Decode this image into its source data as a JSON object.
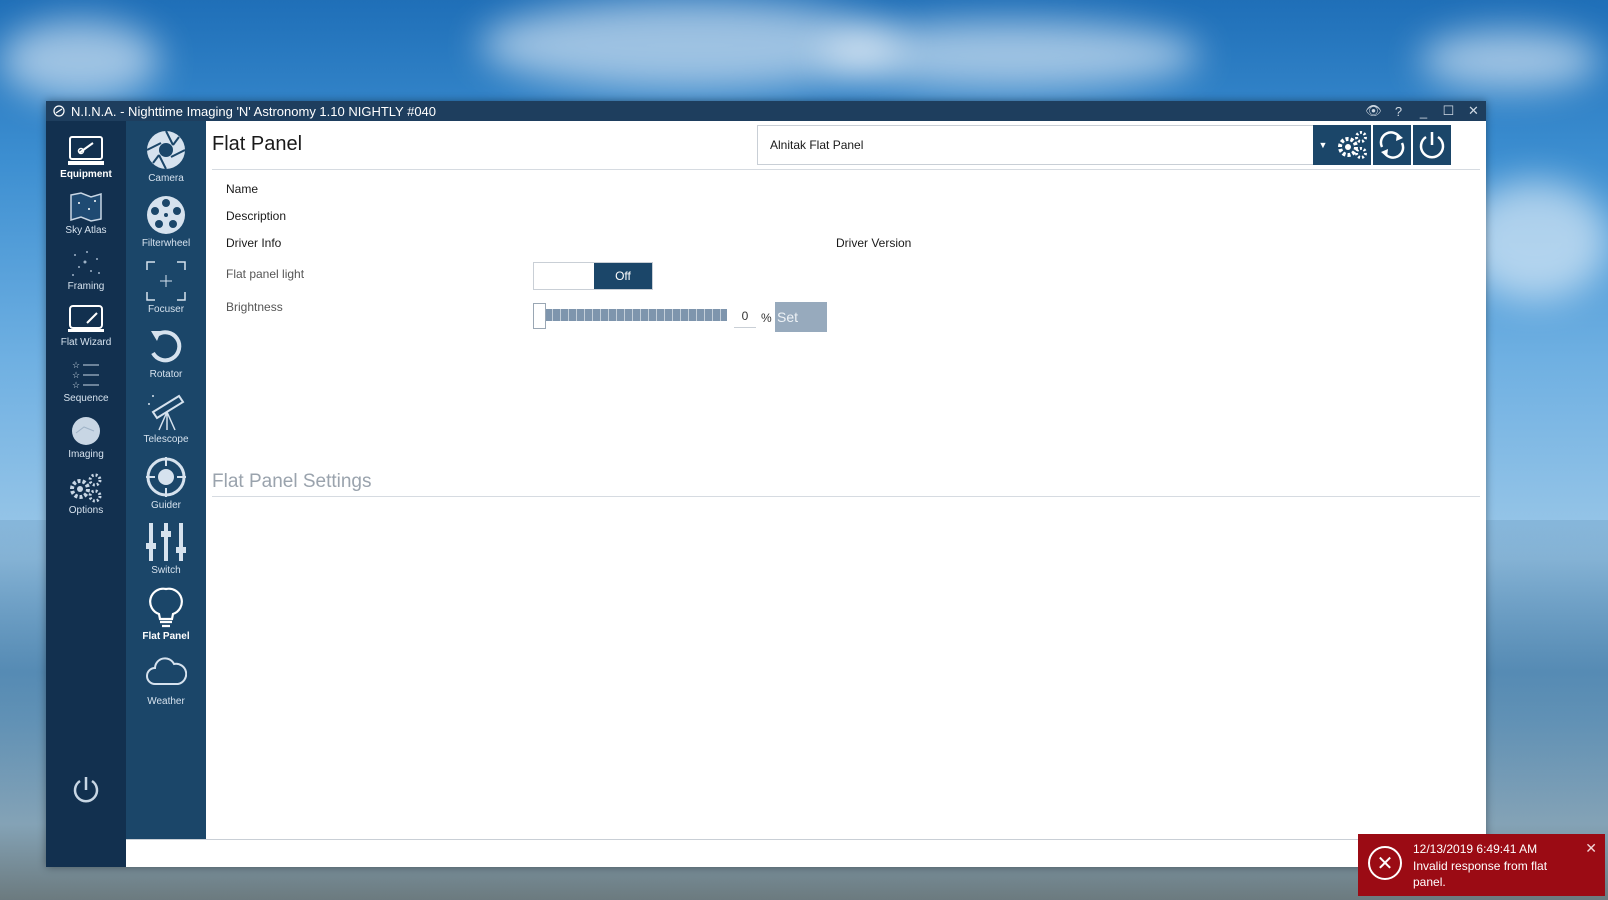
{
  "window": {
    "title": "N.I.N.A. - Nighttime Imaging 'N' Astronomy 1.10 NIGHTLY #040"
  },
  "title_controls": [
    {
      "name": "eye-icon",
      "glyph": "👁"
    },
    {
      "name": "help-icon",
      "glyph": "?"
    },
    {
      "name": "minimize-icon",
      "glyph": "_"
    },
    {
      "name": "maximize-icon",
      "glyph": "☐"
    },
    {
      "name": "close-icon",
      "glyph": "✕"
    }
  ],
  "main_nav": {
    "items": [
      {
        "label": "Equipment",
        "icon": "equipment-icon",
        "active": true
      },
      {
        "label": "Sky Atlas",
        "icon": "sky-atlas-icon"
      },
      {
        "label": "Framing",
        "icon": "framing-icon"
      },
      {
        "label": "Flat Wizard",
        "icon": "flat-wizard-icon"
      },
      {
        "label": "Sequence",
        "icon": "sequence-icon"
      },
      {
        "label": "Imaging",
        "icon": "imaging-icon"
      },
      {
        "label": "Options",
        "icon": "options-icon"
      }
    ],
    "power_icon": "power-icon"
  },
  "equipment_nav": {
    "items": [
      {
        "label": "Camera",
        "icon": "camera-aperture-icon"
      },
      {
        "label": "Filterwheel",
        "icon": "filterwheel-icon"
      },
      {
        "label": "Focuser",
        "icon": "focuser-icon"
      },
      {
        "label": "Rotator",
        "icon": "rotator-icon"
      },
      {
        "label": "Telescope",
        "icon": "telescope-icon"
      },
      {
        "label": "Guider",
        "icon": "guider-icon"
      },
      {
        "label": "Switch",
        "icon": "switch-icon"
      },
      {
        "label": "Flat Panel",
        "icon": "lightbulb-icon",
        "active": true
      },
      {
        "label": "Weather",
        "icon": "cloud-icon"
      }
    ]
  },
  "page": {
    "title": "Flat Panel",
    "device_selected": "Alnitak Flat Panel",
    "fields": {
      "name_label": "Name",
      "description_label": "Description",
      "driver_info_label": "Driver Info",
      "driver_version_label": "Driver Version"
    },
    "controls": {
      "light_label": "Flat panel light",
      "light_state": "Off",
      "brightness_label": "Brightness",
      "brightness_value": "0",
      "brightness_unit": "%",
      "set_label": "Set"
    },
    "settings_title": "Flat Panel Settings"
  },
  "notification": {
    "timestamp": "12/13/2019 6:49:41 AM",
    "message": "Invalid response from flat panel.",
    "type": "error"
  }
}
